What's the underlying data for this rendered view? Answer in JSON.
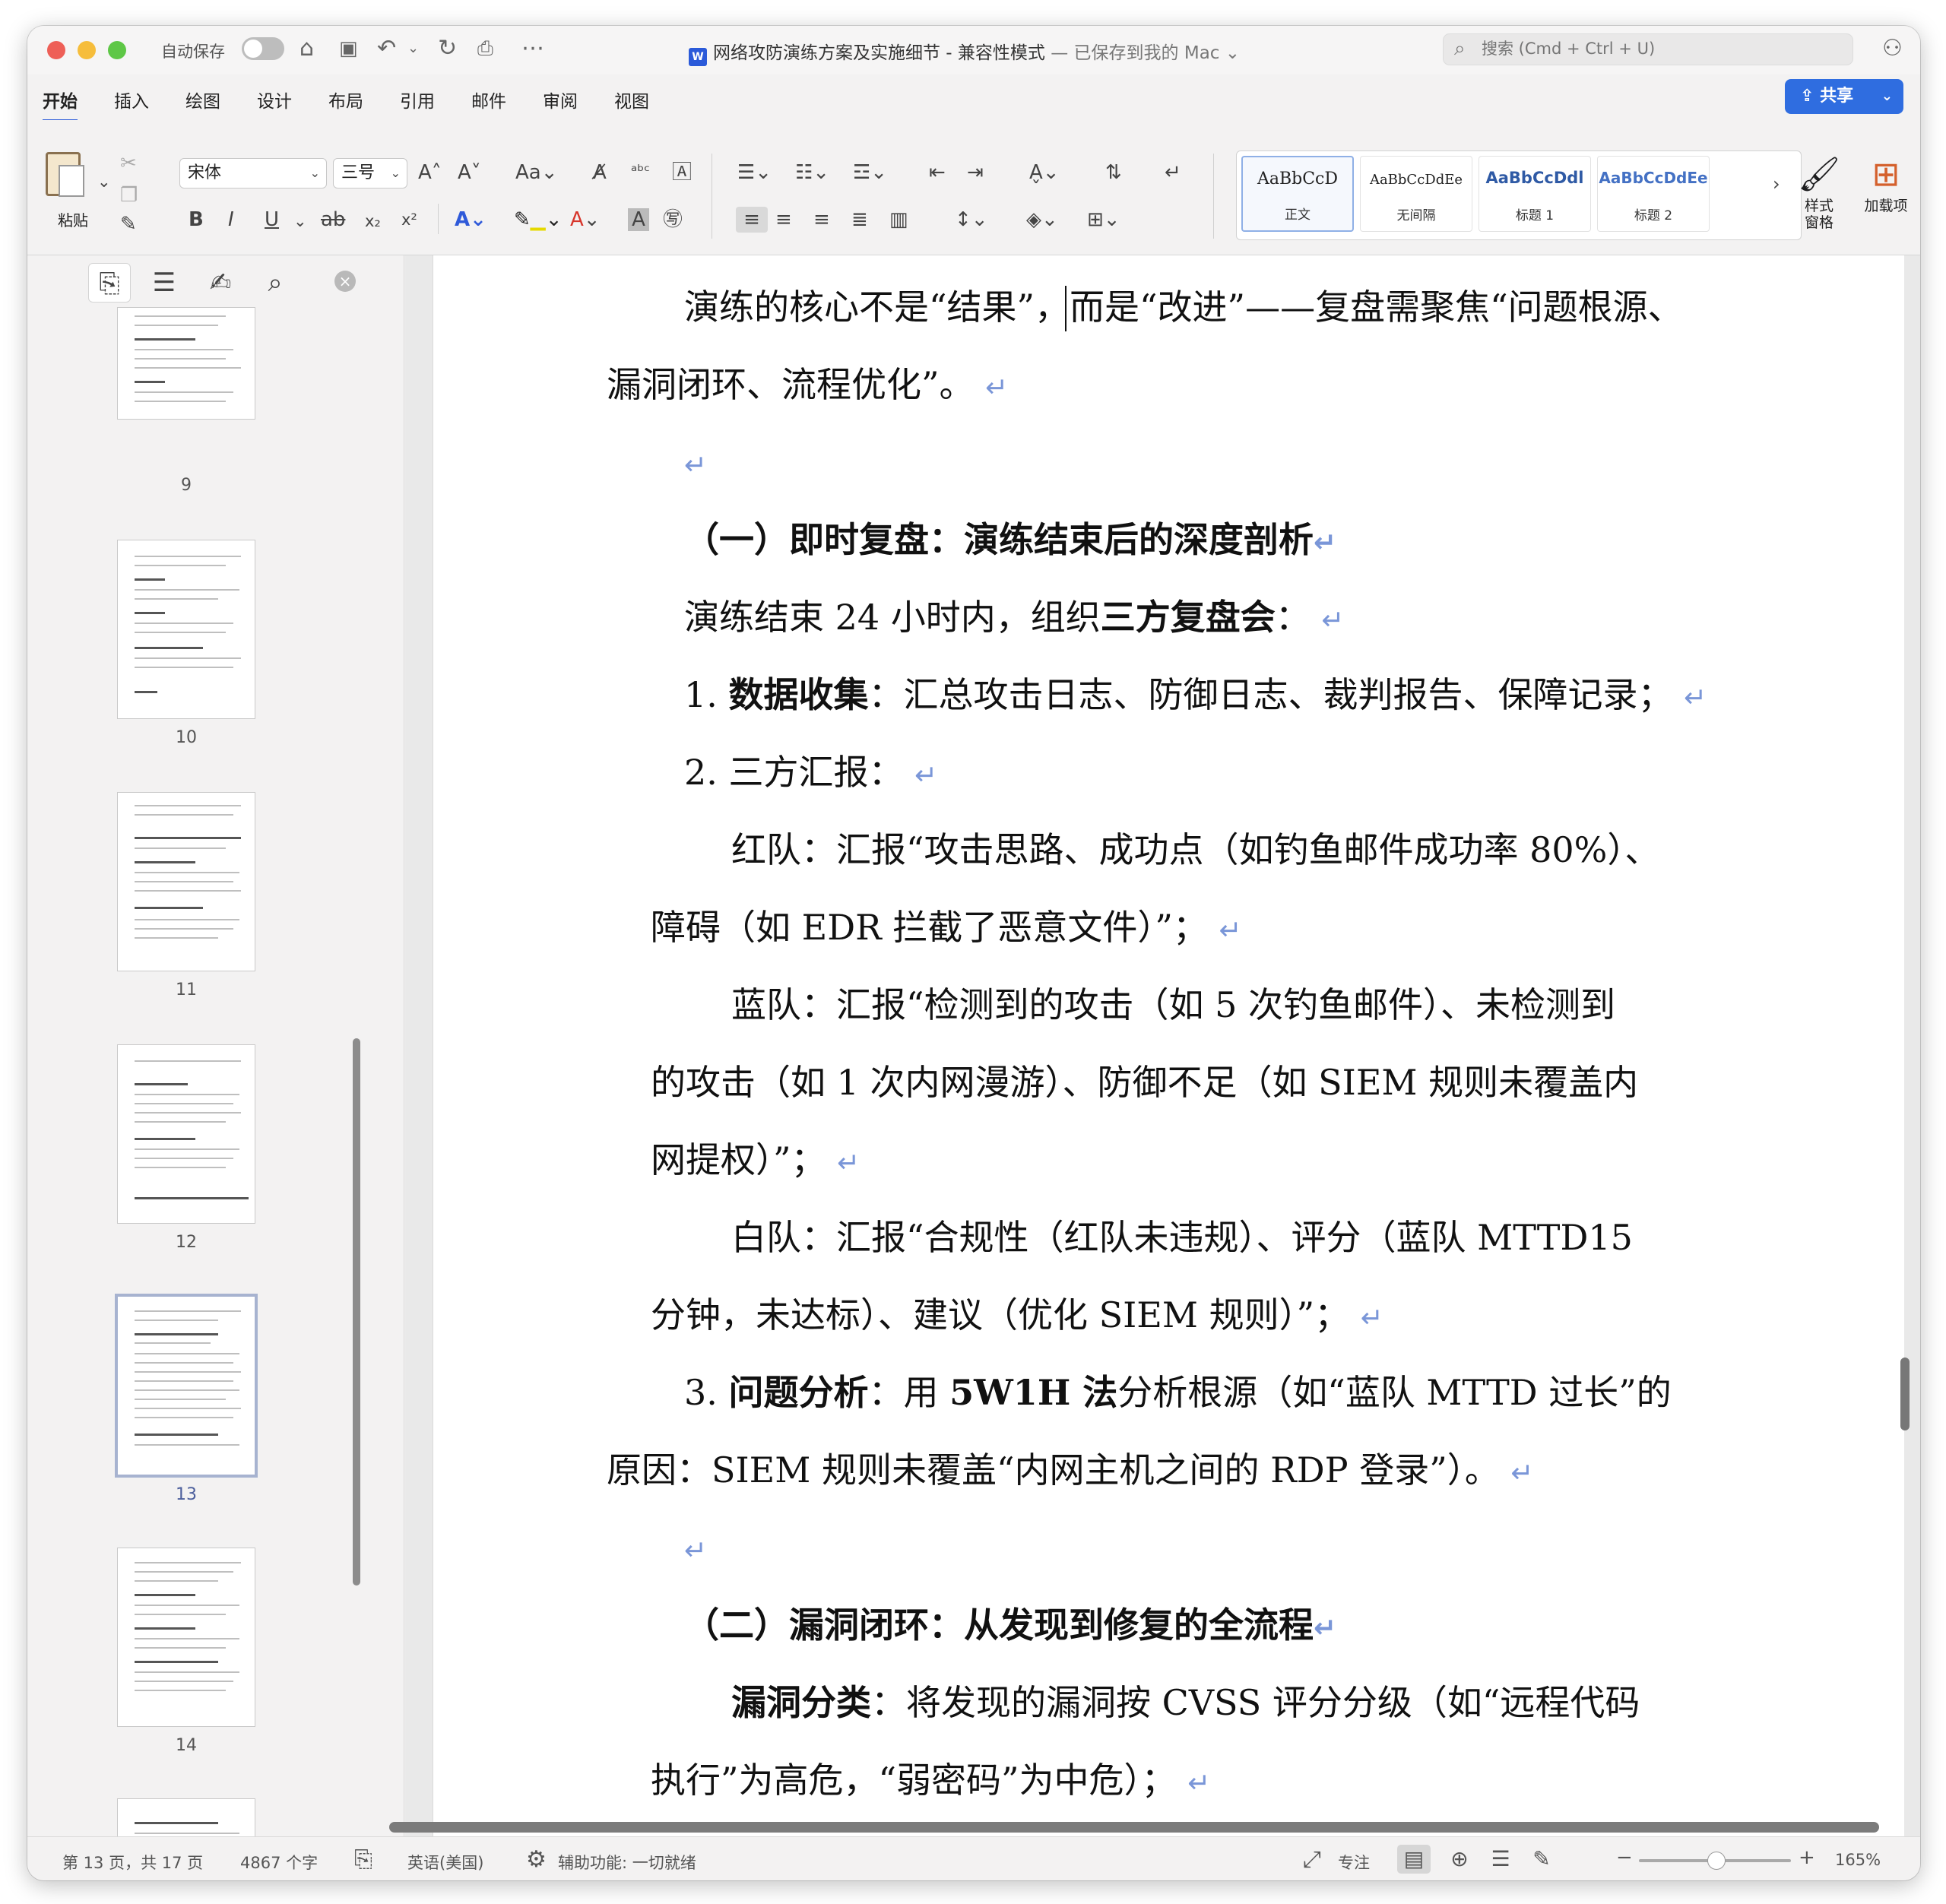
{
  "titlebar": {
    "autosave_label": "自动保存",
    "doc_name": "网络攻防演练方案及实施细节",
    "separator": " - ",
    "mode": "兼容性模式",
    "saved_status": " — 已保存到我的 Mac",
    "search_placeholder": "搜索 (Cmd + Ctrl + U)"
  },
  "tabs": [
    "开始",
    "插入",
    "绘图",
    "设计",
    "布局",
    "引用",
    "邮件",
    "审阅",
    "视图"
  ],
  "share_label": "共享",
  "ribbon": {
    "paste_label": "粘贴",
    "font_name": "宋体",
    "font_size": "三号",
    "styles": [
      {
        "sample": "AaBbCcD",
        "name": "正文"
      },
      {
        "sample": "AaBbCcDdEe",
        "name": "无间隔"
      },
      {
        "sample": "AaBbCcDdl",
        "name": "标题 1"
      },
      {
        "sample": "AaBbCcDdEe",
        "name": "标题 2"
      }
    ],
    "styles_pane_label": "样式\n窗格",
    "addins_label": "加载项"
  },
  "nav": {
    "page_numbers": [
      "9",
      "10",
      "11",
      "12",
      "13",
      "14"
    ]
  },
  "document": {
    "line1": "演练的核心不是“结果”，而是“改进”——复盘需聚焦“问题根源、",
    "line2": "漏洞闭环、流程优化”。",
    "heading1": "（一）即时复盘：演练结束后的深度剖析",
    "line4_a": "演练结束 24 小时内，组织",
    "line4_b": "三方复盘会",
    "line4_c": "：",
    "item1_num": "1. ",
    "item1_bold": "数据收集",
    "item1_rest": "：汇总攻击日志、防御日志、裁判报告、保障记录；",
    "item2": "2. 三方汇报：",
    "red1": "红队：汇报“攻击思路、成功点（如钓鱼邮件成功率  80%）、",
    "red2": "障碍（如 EDR 拦截了恶意文件）”；",
    "blue1": "蓝队：汇报“检测到的攻击（如 5 次钓鱼邮件）、未检测到",
    "blue2": "的攻击（如 1 次内网漫游）、防御不足（如 SIEM 规则未覆盖内",
    "blue3": "网提权）”；",
    "white1": "白队：汇报“合规性（红队未违规）、评分（蓝队 MTTD15",
    "white2": "分钟，未达标）、建议（优化 SIEM 规则）”；",
    "item3_num": "3. ",
    "item3_bold": "问题分析",
    "item3_a": "：用 ",
    "item3_bold2": "5W1H 法",
    "item3_b": "分析根源（如“蓝队 MTTD 过长”的",
    "item3_c": "原因：SIEM 规则未覆盖“内网主机之间的 RDP 登录”）。",
    "heading2": "（二）漏洞闭环：从发现到修复的全流程",
    "vuln_bold": "漏洞分类",
    "vuln_rest": "：将发现的漏洞按 CVSS 评分分级（如“远程代码",
    "vuln2": "执行”为高危，“弱密码”为中危）；",
    "para_mark": "↵"
  },
  "status": {
    "page_info": "第 13 页，共 17 页",
    "word_count": "4867 个字",
    "language": "英语(美国)",
    "accessibility": "辅助功能: 一切就绪",
    "focus": "专注",
    "zoom": "165%"
  }
}
